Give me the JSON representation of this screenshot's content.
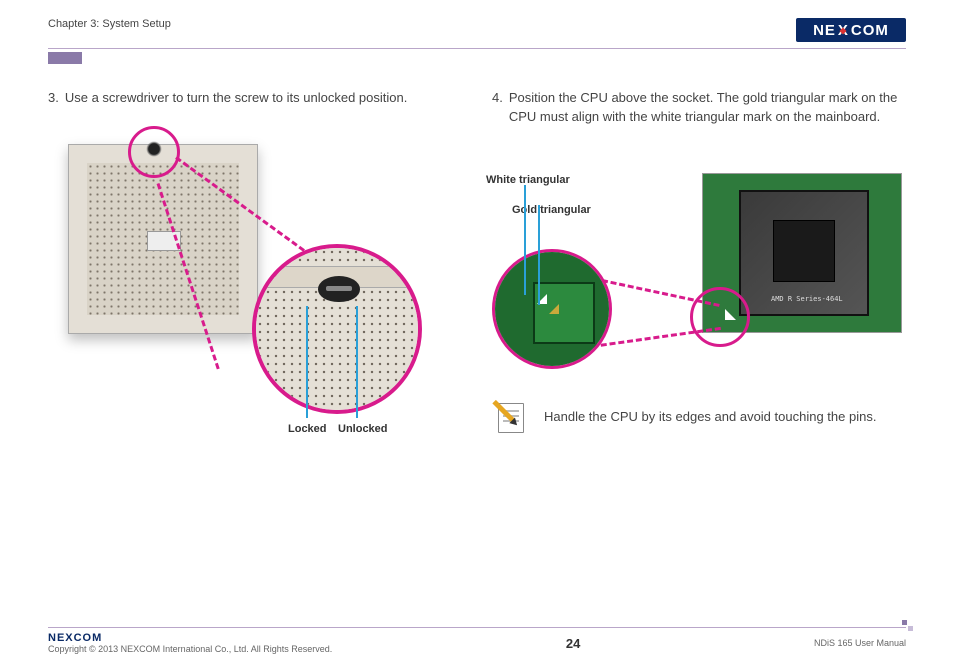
{
  "header": {
    "chapter": "Chapter 3: System Setup",
    "logo_pre": "NE",
    "logo_x": "X",
    "logo_post": "COM"
  },
  "left": {
    "step_num": "3.",
    "step_text": "Use a screwdriver to turn the screw to its unlocked position.",
    "label_locked": "Locked",
    "label_unlocked": "Unlocked"
  },
  "right": {
    "step_num": "4.",
    "step_text": "Position the CPU above the socket. The gold triangular mark on the CPU must align with the white triangular mark on the mainboard.",
    "label_white": "White triangular",
    "label_gold": "Gold triangular",
    "cpu_text": "AMD R Series-464L",
    "note_text": "Handle the CPU by its edges and avoid touching the pins."
  },
  "footer": {
    "logo": "NEXCOM",
    "copyright": "Copyright © 2013 NEXCOM International Co., Ltd. All Rights Reserved.",
    "page": "24",
    "doc": "NDiS 165 User Manual"
  }
}
